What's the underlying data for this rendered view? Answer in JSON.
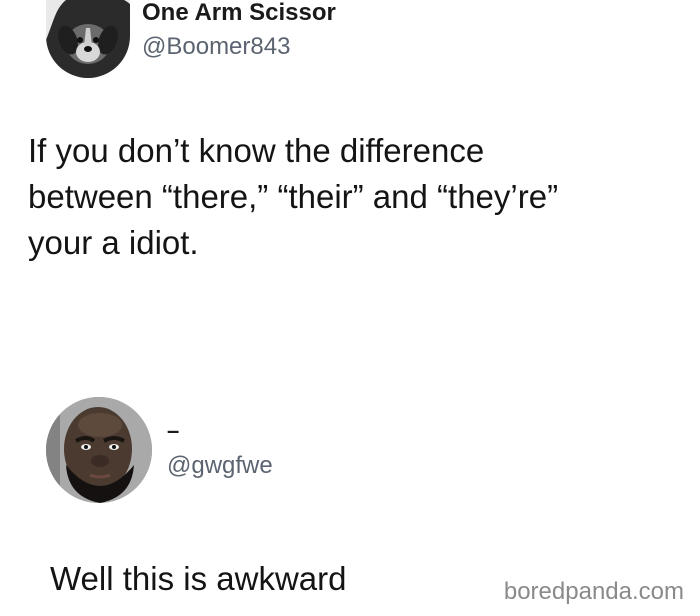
{
  "tweet_1": {
    "display_name": "One Arm Scissor",
    "handle": "@Boomer843",
    "text_lines": [
      "If you don’t know the difference",
      "between “there,” “their” and “they’re”",
      "your a idiot."
    ]
  },
  "tweet_2": {
    "display_name": "–",
    "handle": "@gwgfwe",
    "text": "Well this is awkward"
  },
  "watermark": "boredpanda.com"
}
